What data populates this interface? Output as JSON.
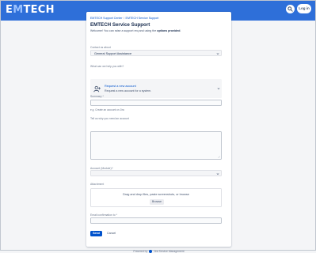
{
  "header": {
    "logo_prefix": "E",
    "logo_accent": "M",
    "logo_suffix": "TECH",
    "login_label": "Log in",
    "search_icon": "search-icon"
  },
  "breadcrumb": {
    "items": [
      "EMTECH Support Center",
      "EMTECH Service Support"
    ],
    "separator": "/"
  },
  "page": {
    "title": "EMTECH Service Support",
    "intro_prefix": "Welcome! You can raise a support req and using the ",
    "intro_bold": "options provided",
    "intro_suffix": "."
  },
  "form": {
    "contact_label": "Contact us about",
    "contact_value": "General Support Assistance",
    "help_label": "What can we help you with?",
    "request_type_title": "Request a new account",
    "request_type_desc": "Request a new account for a system.",
    "summary_label": "Summary *",
    "summary_help": "e.g. Create an account on Jira",
    "description_label": "Tell us why you need an account",
    "accounts_label": "Account (Module)?",
    "attachment_label": "Attachment",
    "dropzone_text": "Drag and drop files, paste screenshots, or browse",
    "browse_label": "Browse",
    "email_label": "Email confirmation to *",
    "send_label": "Send",
    "cancel_label": "Cancel"
  },
  "footer": {
    "powered_prefix": "Powered by",
    "powered_suffix": "Jira Service Management"
  },
  "colors": {
    "topbar": "#2e6fd9",
    "primary": "#0052cc",
    "page_bg": "#f4f5f7"
  }
}
